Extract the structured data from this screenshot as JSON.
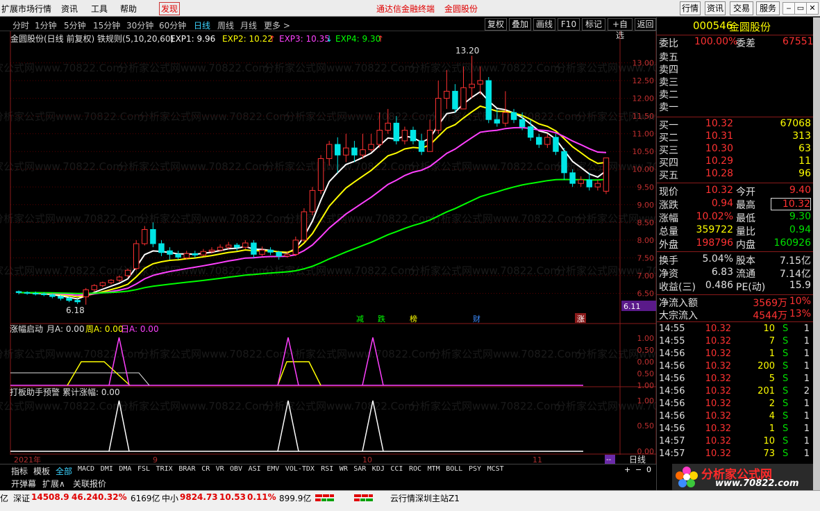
{
  "menu": {
    "items": [
      "扩展市场行情",
      "资讯",
      "工具",
      "帮助"
    ],
    "discover": "发现",
    "center_title": "通达信金融终端",
    "center_stock": "金圆股份",
    "right_buttons": [
      "行情",
      "资讯",
      "交易",
      "服务"
    ]
  },
  "periods": {
    "items": [
      "分时",
      "1分钟",
      "5分钟",
      "15分钟",
      "30分钟",
      "60分钟",
      "日线",
      "周线",
      "月线",
      "更多 >"
    ],
    "active": "日线"
  },
  "toolbar": {
    "buttons": [
      "复权",
      "叠加",
      "画线",
      "F10",
      "标记",
      "+自选",
      "返回"
    ]
  },
  "chart": {
    "title": "金圆股份(日线 前复权) 铁规则(5,10,20,60)",
    "exp1": "EXP1: 9.96",
    "exp2": "EXP2: 10.22",
    "exp3": "EXP3: 10.35",
    "exp4": "EXP4: 9.30",
    "exp2_arrow": "↑",
    "exp3_arrow": "↓",
    "exp4_arrow": "↑",
    "high_label": "13.20",
    "low_label": "6.18",
    "price_flag": "6.11",
    "watermark": "分析家公式网www.70822.Com",
    "price_ticks": [
      "13.00",
      "12.50",
      "12.00",
      "11.50",
      "11.00",
      "10.50",
      "10.00",
      "9.50",
      "9.00",
      "8.50",
      "8.00",
      "7.50",
      "7.00",
      "6.50"
    ],
    "event_labels": [
      "减",
      "跌",
      "榜",
      "财",
      "涨"
    ],
    "colors": {
      "ma5": "#ffffff",
      "ma10": "#ffff00",
      "ma20": "#ff40ff",
      "ma60": "#00ff00",
      "up": "#ff3232",
      "down": "#00e5e5"
    }
  },
  "chart_data": {
    "type": "line",
    "title": "金圆股份(日线 前复权) 铁规则(5,10,20,60)",
    "series": [
      {
        "name": "EXP1",
        "last": 9.96
      },
      {
        "name": "EXP2",
        "last": 10.22
      },
      {
        "name": "EXP3",
        "last": 10.35
      },
      {
        "name": "EXP4",
        "last": 9.3
      }
    ],
    "candles": [
      [
        6.55,
        6.52,
        6.58,
        6.47
      ],
      [
        6.52,
        6.5,
        6.56,
        6.46
      ],
      [
        6.5,
        6.48,
        6.55,
        6.44
      ],
      [
        6.48,
        6.46,
        6.53,
        6.42
      ],
      [
        6.46,
        6.41,
        6.5,
        6.36
      ],
      [
        6.41,
        6.36,
        6.45,
        6.3
      ],
      [
        6.36,
        6.3,
        6.4,
        6.25
      ],
      [
        6.3,
        6.26,
        6.34,
        6.2
      ],
      [
        6.4,
        6.6,
        6.65,
        6.18
      ],
      [
        6.6,
        6.72,
        6.76,
        6.55
      ],
      [
        6.72,
        6.8,
        6.83,
        6.67
      ],
      [
        6.8,
        6.87,
        6.9,
        6.75
      ],
      [
        6.87,
        6.96,
        7.0,
        6.82
      ],
      [
        7.0,
        7.15,
        7.2,
        6.95
      ],
      [
        7.2,
        7.9,
        8.0,
        7.15
      ],
      [
        7.9,
        8.3,
        8.4,
        7.85
      ],
      [
        8.3,
        7.9,
        8.5,
        7.8
      ],
      [
        7.9,
        7.65,
        8.0,
        7.55
      ],
      [
        7.7,
        7.6,
        7.8,
        7.45
      ],
      [
        7.6,
        7.52,
        7.7,
        7.45
      ],
      [
        7.5,
        7.62,
        7.7,
        7.45
      ],
      [
        7.62,
        7.58,
        7.7,
        7.5
      ],
      [
        7.58,
        7.68,
        7.75,
        7.55
      ],
      [
        7.68,
        7.72,
        7.8,
        7.62
      ],
      [
        7.72,
        7.8,
        7.88,
        7.68
      ],
      [
        7.8,
        7.86,
        7.95,
        7.75
      ],
      [
        7.86,
        7.8,
        7.92,
        7.7
      ],
      [
        7.8,
        7.92,
        8.0,
        7.75
      ],
      [
        7.92,
        7.6,
        8.0,
        7.5
      ],
      [
        7.6,
        7.72,
        7.82,
        7.55
      ],
      [
        7.72,
        7.66,
        7.8,
        7.58
      ],
      [
        7.66,
        7.55,
        7.7,
        7.45
      ],
      [
        7.55,
        7.6,
        7.68,
        7.5
      ],
      [
        7.6,
        8.0,
        8.1,
        7.55
      ],
      [
        8.0,
        8.8,
        8.9,
        7.95
      ],
      [
        8.8,
        9.4,
        9.5,
        8.7
      ],
      [
        9.4,
        10.3,
        10.4,
        9.3
      ],
      [
        10.3,
        10.7,
        10.8,
        10.1
      ],
      [
        10.7,
        10.4,
        10.9,
        9.9
      ],
      [
        10.4,
        10.6,
        11.0,
        10.2
      ],
      [
        10.6,
        10.4,
        10.8,
        10.2
      ],
      [
        10.4,
        10.55,
        11.0,
        10.3
      ],
      [
        10.55,
        10.7,
        11.0,
        10.5
      ],
      [
        10.7,
        11.1,
        11.6,
        10.6
      ],
      [
        11.1,
        11.3,
        11.7,
        11.0
      ],
      [
        11.3,
        10.8,
        11.5,
        10.7
      ],
      [
        10.8,
        11.1,
        11.2,
        10.7
      ],
      [
        11.1,
        10.8,
        11.2,
        10.7
      ],
      [
        10.8,
        10.5,
        11.0,
        10.4
      ],
      [
        10.5,
        11.1,
        11.4,
        10.5
      ],
      [
        11.1,
        12.0,
        12.5,
        11.0
      ],
      [
        12.0,
        12.2,
        12.8,
        11.7
      ],
      [
        12.2,
        11.7,
        12.4,
        11.6
      ],
      [
        11.7,
        12.3,
        12.9,
        11.7
      ],
      [
        12.3,
        12.4,
        13.2,
        12.0
      ],
      [
        12.4,
        12.5,
        12.9,
        12.1
      ],
      [
        12.5,
        11.4,
        12.6,
        11.3
      ],
      [
        11.4,
        11.3,
        11.7,
        11.2
      ],
      [
        11.3,
        11.6,
        12.2,
        11.2
      ],
      [
        11.6,
        11.4,
        11.7,
        11.3
      ],
      [
        11.4,
        11.2,
        11.6,
        11.1
      ],
      [
        11.2,
        10.9,
        11.4,
        10.8
      ],
      [
        10.9,
        10.7,
        11.0,
        10.6
      ],
      [
        10.7,
        10.9,
        11.0,
        10.6
      ],
      [
        10.9,
        10.5,
        11.0,
        10.4
      ],
      [
        10.5,
        9.9,
        10.6,
        9.7
      ],
      [
        9.9,
        9.6,
        10.0,
        9.5
      ],
      [
        9.6,
        9.7,
        9.8,
        9.5
      ],
      [
        9.7,
        9.5,
        9.9,
        9.4
      ],
      [
        9.5,
        9.6,
        9.7,
        9.4
      ],
      [
        9.38,
        10.32,
        10.32,
        9.3
      ]
    ],
    "ylim": [
      6.0,
      13.5
    ]
  },
  "indicators": {
    "panel1_title": "涨幅启动",
    "panel1_a": "月A: 0.00",
    "panel1_b": "周A: 0.00",
    "panel1_c": "日A: 0.00",
    "panel1_ticks": [
      "1.00",
      "0.50",
      "0.00",
      "0.50",
      "1.00"
    ],
    "panel2_title": "打板助手预警",
    "panel2_value": "累计涨幅: 0.00",
    "panel2_ticks": [
      "1.00",
      "0.50",
      "0.00"
    ],
    "timeline": [
      "2021年",
      "9",
      "10",
      "11"
    ],
    "timeline_btn": "--",
    "period_btn": "日线"
  },
  "bottom_tabs": {
    "tabs": [
      "指标",
      "模板",
      "全部",
      "MACD",
      "DMI",
      "DMA",
      "FSL",
      "TRIX",
      "BRAR",
      "CR",
      "VR",
      "OBV",
      "ASI",
      "EMV",
      "VOL-TDX",
      "RSI",
      "WR",
      "SAR",
      "KDJ",
      "CCI",
      "ROC",
      "MTM",
      "BOLL",
      "PSY",
      "MCST"
    ],
    "active": "全部",
    "row2": [
      "开弹幕",
      "扩展∧",
      "关联报价"
    ],
    "zoom": [
      "+",
      "−",
      "0"
    ]
  },
  "quote": {
    "code": "000546",
    "name": "金圆股份",
    "webi_label": "委比",
    "webi": "100.00%",
    "weicha_label": "委差",
    "weicha": "67551",
    "sell": [
      "卖五",
      "卖四",
      "卖三",
      "卖二",
      "卖一"
    ],
    "buy": [
      {
        "label": "买一",
        "price": "10.32",
        "vol": "67068"
      },
      {
        "label": "买二",
        "price": "10.31",
        "vol": "313"
      },
      {
        "label": "买三",
        "price": "10.30",
        "vol": "63"
      },
      {
        "label": "买四",
        "price": "10.29",
        "vol": "11"
      },
      {
        "label": "买五",
        "price": "10.28",
        "vol": "96"
      }
    ],
    "stats": [
      {
        "l1": "现价",
        "v1": "10.32",
        "c1": "#ff3232",
        "l2": "今开",
        "v2": "9.40",
        "c2": "#ff3232"
      },
      {
        "l1": "涨跌",
        "v1": "0.94",
        "c1": "#ff3232",
        "l2": "最高",
        "v2": "10.32",
        "c2": "#ff3232"
      },
      {
        "l1": "涨幅",
        "v1": "10.02%",
        "c1": "#ff3232",
        "l2": "最低",
        "v2": "9.30",
        "c2": "#00e000"
      },
      {
        "l1": "总量",
        "v1": "359722",
        "c1": "#ffff00",
        "l2": "量比",
        "v2": "0.94",
        "c2": "#00e000"
      },
      {
        "l1": "外盘",
        "v1": "198796",
        "c1": "#ff3232",
        "l2": "内盘",
        "v2": "160926",
        "c2": "#00e000"
      },
      {
        "l1": "换手",
        "v1": "5.04%",
        "c1": "#e0e0e0",
        "l2": "股本",
        "v2": "7.15亿",
        "c2": "#e0e0e0"
      },
      {
        "l1": "净资",
        "v1": "6.83",
        "c1": "#e0e0e0",
        "l2": "流通",
        "v2": "7.14亿",
        "c2": "#e0e0e0"
      },
      {
        "l1": "收益(三)",
        "v1": "0.486",
        "c1": "#e0e0e0",
        "l2": "PE(动)",
        "v2": "15.9",
        "c2": "#e0e0e0"
      }
    ],
    "flow": [
      {
        "label": "净流入额",
        "value": "3569万",
        "pct": "10%"
      },
      {
        "label": "大宗流入",
        "value": "4544万",
        "pct": "13%"
      }
    ]
  },
  "ticks": [
    {
      "time": "14:55",
      "price": "10.32",
      "vol": "10",
      "side": "S",
      "n": "1"
    },
    {
      "time": "14:55",
      "price": "10.32",
      "vol": "7",
      "side": "S",
      "n": "1"
    },
    {
      "time": "14:56",
      "price": "10.32",
      "vol": "1",
      "side": "S",
      "n": "1"
    },
    {
      "time": "14:56",
      "price": "10.32",
      "vol": "200",
      "side": "S",
      "n": "1"
    },
    {
      "time": "14:56",
      "price": "10.32",
      "vol": "5",
      "side": "S",
      "n": "1"
    },
    {
      "time": "14:56",
      "price": "10.32",
      "vol": "201",
      "side": "S",
      "n": "2"
    },
    {
      "time": "14:56",
      "price": "10.32",
      "vol": "2",
      "side": "S",
      "n": "1"
    },
    {
      "time": "14:56",
      "price": "10.32",
      "vol": "4",
      "side": "S",
      "n": "1"
    },
    {
      "time": "14:56",
      "price": "10.32",
      "vol": "1",
      "side": "S",
      "n": "1"
    },
    {
      "time": "14:57",
      "price": "10.32",
      "vol": "10",
      "side": "S",
      "n": "1"
    },
    {
      "time": "14:57",
      "price": "10.32",
      "vol": "73",
      "side": "S",
      "n": "1"
    }
  ],
  "logo": {
    "text": "分析家公式网",
    "url": "www.70822.com"
  },
  "status": {
    "prefix": "亿",
    "shenzheng_label": "深证",
    "shenzheng": "14508.9",
    "sz_change": "46.24",
    "sz_pct": "0.32%",
    "sz_amount": "6169亿",
    "zhongxiao_label": "中小",
    "zhongxiao": "9824.73",
    "zx_change": "10.53",
    "zx_pct": "0.11%",
    "zx_amount": "899.9亿",
    "server": "云行情深圳主站Z1"
  }
}
